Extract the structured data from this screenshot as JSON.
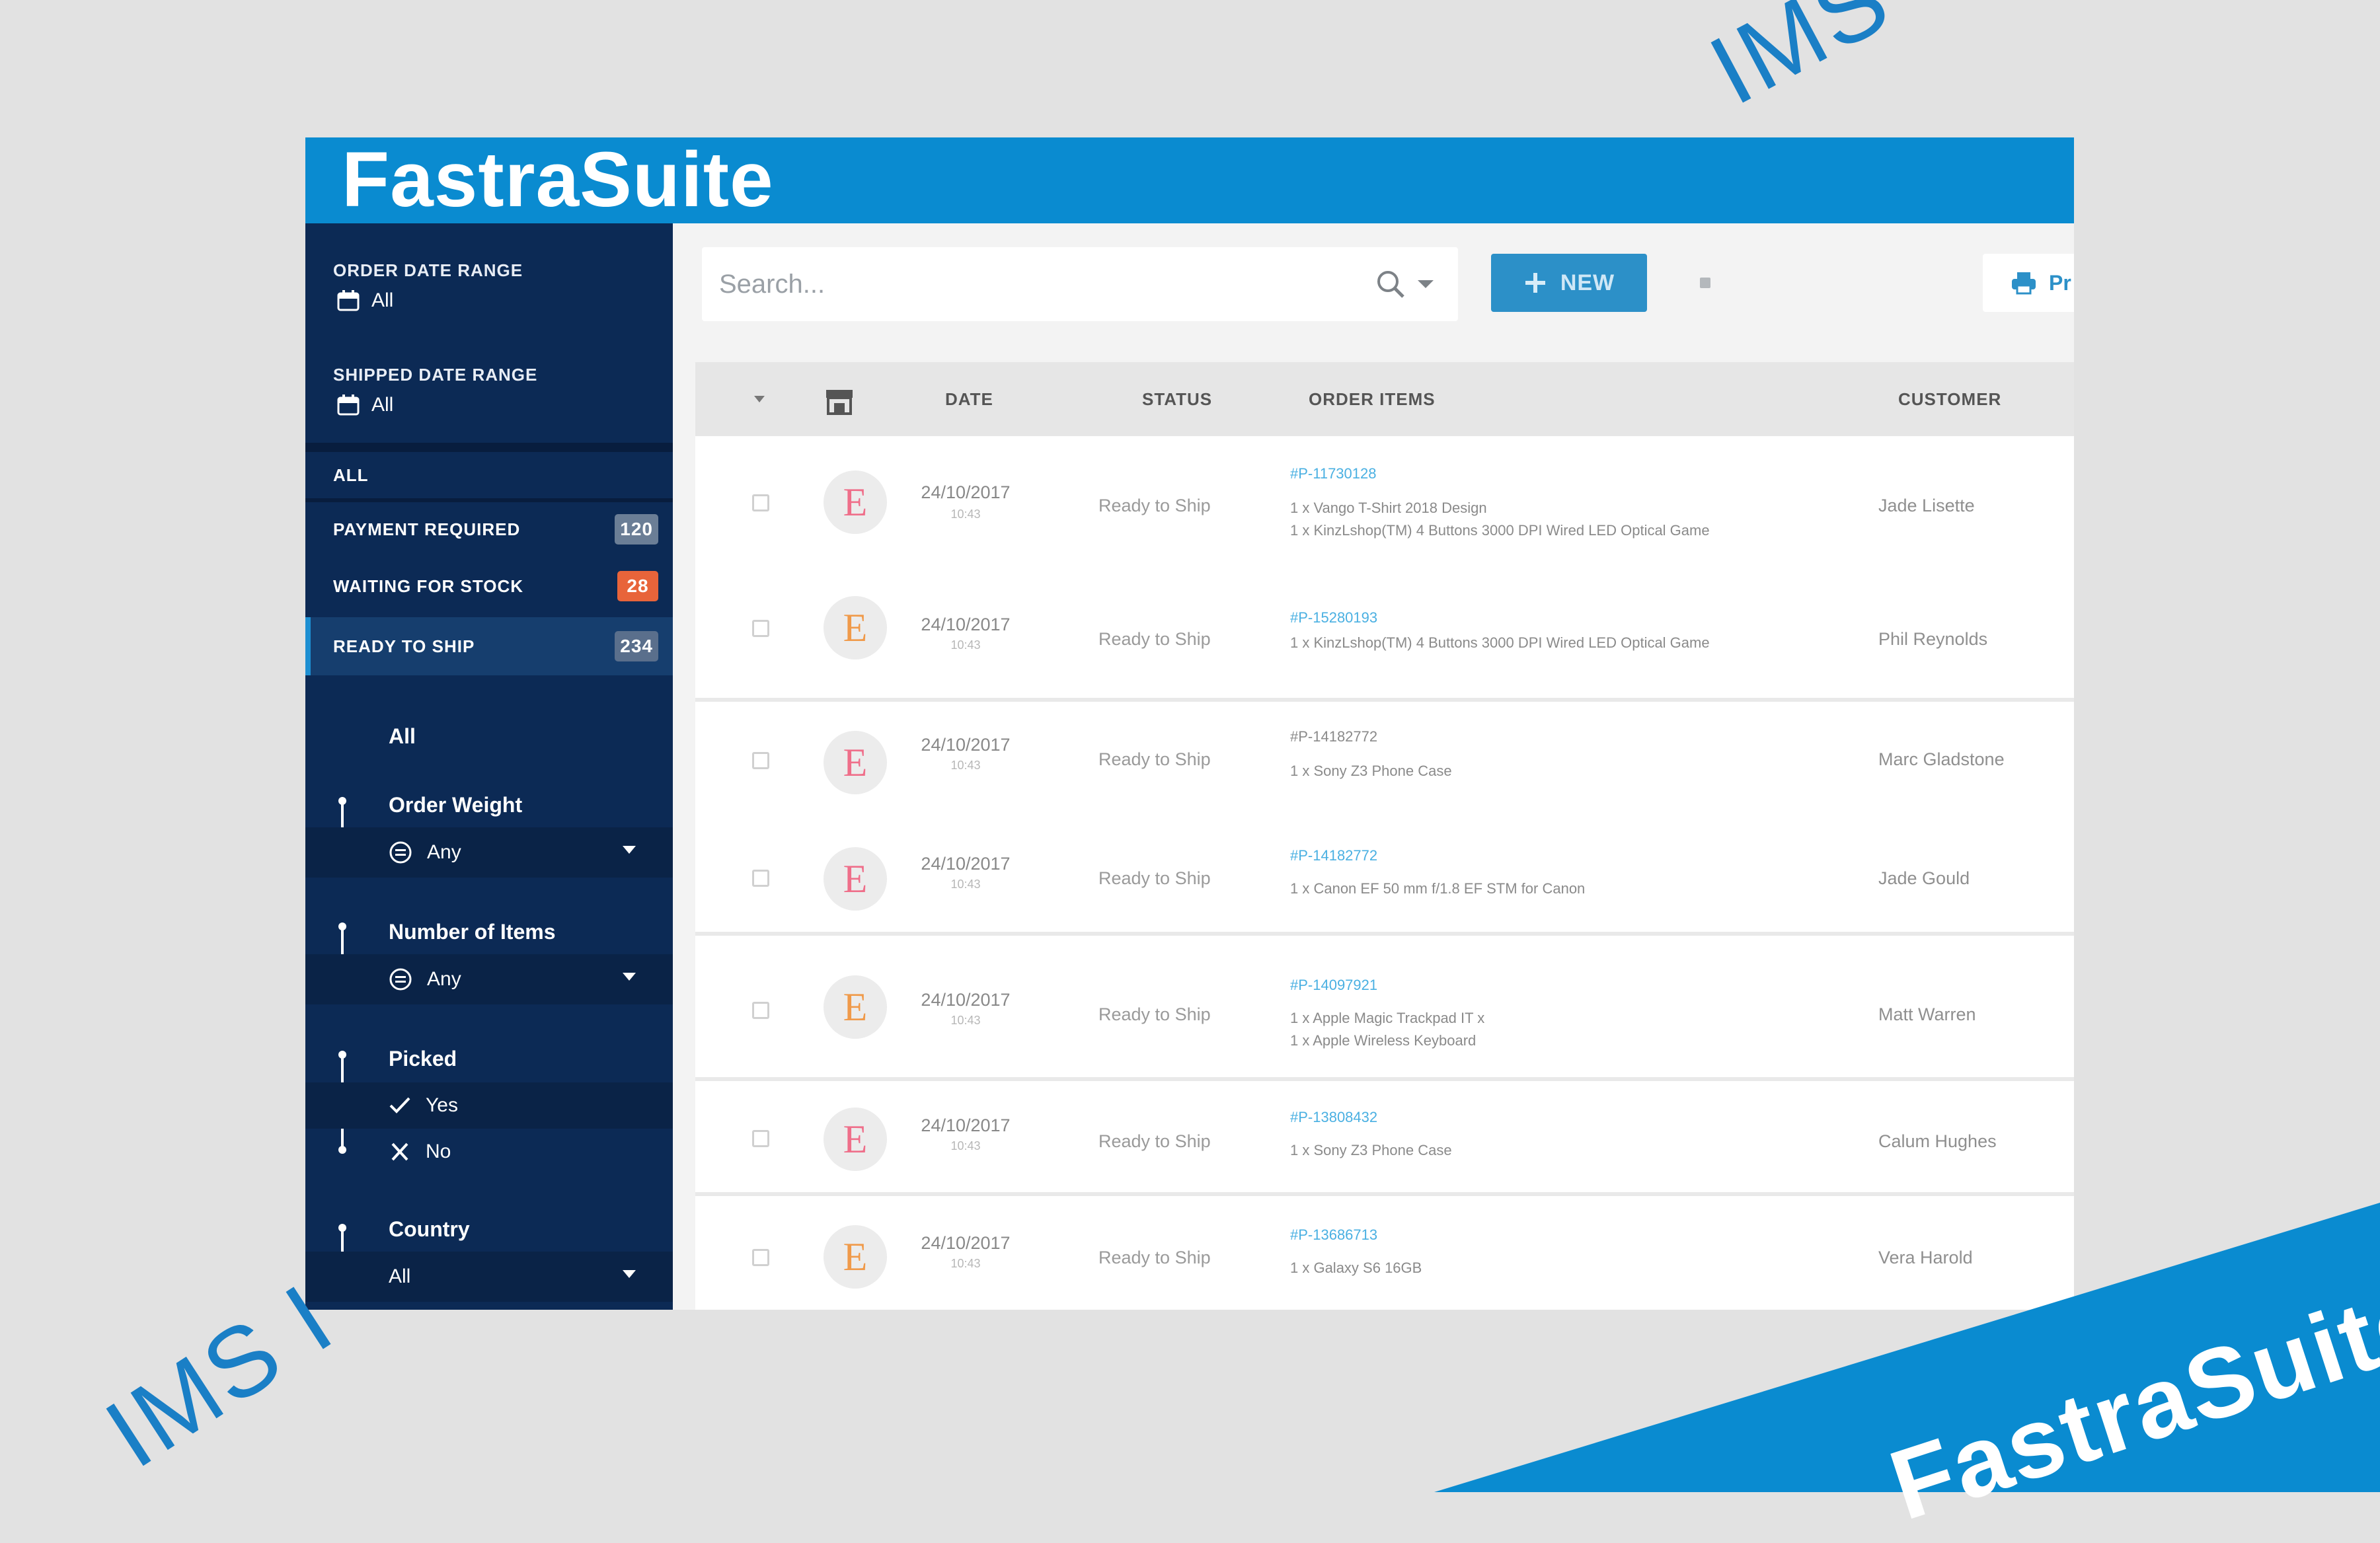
{
  "watermarks": {
    "ims_top": "IMS",
    "ims_bottom": "IMS I",
    "corner_brand": "FastraSuite"
  },
  "brand": {
    "title": "FastraSuite"
  },
  "sidebar": {
    "order_date_range": {
      "label": "ORDER DATE RANGE",
      "value": "All"
    },
    "shipped_date_range": {
      "label": "SHIPPED DATE RANGE",
      "value": "All"
    },
    "status_items": [
      {
        "label": "ALL"
      },
      {
        "label": "PAYMENT REQUIRED",
        "badge": "120",
        "badge_color": "#6b7e96"
      },
      {
        "label": "WAITING FOR STOCK",
        "badge": "28",
        "badge_color": "#e8643a"
      },
      {
        "label": "READY TO SHIP",
        "badge": "234",
        "badge_color": "#5a6f8c"
      }
    ],
    "filters": {
      "all_label": "All",
      "order_weight": {
        "title": "Order Weight",
        "value": "Any"
      },
      "number_of_items": {
        "title": "Number of Items",
        "value": "Any"
      },
      "picked": {
        "title": "Picked",
        "options": [
          "Yes",
          "No"
        ]
      },
      "country": {
        "title": "Country",
        "value": "All"
      }
    }
  },
  "toolbar": {
    "search_placeholder": "Search...",
    "new_label": "NEW",
    "print_label": "Pr"
  },
  "table": {
    "columns": [
      "DATE",
      "STATUS",
      "ORDER ITEMS",
      "CUSTOMER"
    ],
    "rows": [
      {
        "avatar": "E",
        "date": "24/10/2017",
        "time": "10:43",
        "status": "Ready to Ship",
        "order_no": "#P-11730128",
        "items": [
          "1 x Vango T-Shirt 2018 Design",
          "1 x KinzLshop(TM) 4 Buttons 3000 DPI Wired LED Optical Game"
        ],
        "customer": "Jade Lisette"
      },
      {
        "avatar": "E",
        "date": "24/10/2017",
        "time": "10:43",
        "status": "Ready to Ship",
        "order_no": "#P-15280193",
        "items": [
          "1 x KinzLshop(TM) 4 Buttons 3000 DPI Wired LED Optical Game"
        ],
        "customer": "Phil Reynolds"
      },
      {
        "avatar": "E",
        "date": "24/10/2017",
        "time": "10:43",
        "status": "Ready to Ship",
        "order_no": "#P-14182772",
        "items": [
          "1 x Sony Z3 Phone Case"
        ],
        "customer": "Marc Gladstone"
      },
      {
        "avatar": "E",
        "date": "24/10/2017",
        "time": "10:43",
        "status": "Ready to Ship",
        "order_no": "#P-14182772",
        "items": [
          "1 x Canon EF 50 mm f/1.8 EF STM for Canon"
        ],
        "customer": "Jade Gould"
      },
      {
        "avatar": "E",
        "date": "24/10/2017",
        "time": "10:43",
        "status": "Ready to Ship",
        "order_no": "#P-14097921",
        "items": [
          "1 x Apple Magic Trackpad IT x",
          "1 x Apple Wireless Keyboard"
        ],
        "customer": "Matt Warren"
      },
      {
        "avatar": "E",
        "date": "24/10/2017",
        "time": "10:43",
        "status": "Ready to Ship",
        "order_no": "#P-13808432",
        "items": [
          "1 x Sony Z3 Phone Case"
        ],
        "customer": "Calum Hughes"
      },
      {
        "avatar": "E",
        "date": "24/10/2017",
        "time": "10:43",
        "status": "Ready to Ship",
        "order_no": "#P-13686713",
        "items": [
          "1 x Galaxy S6 16GB"
        ],
        "customer": "Vera Harold"
      }
    ]
  }
}
